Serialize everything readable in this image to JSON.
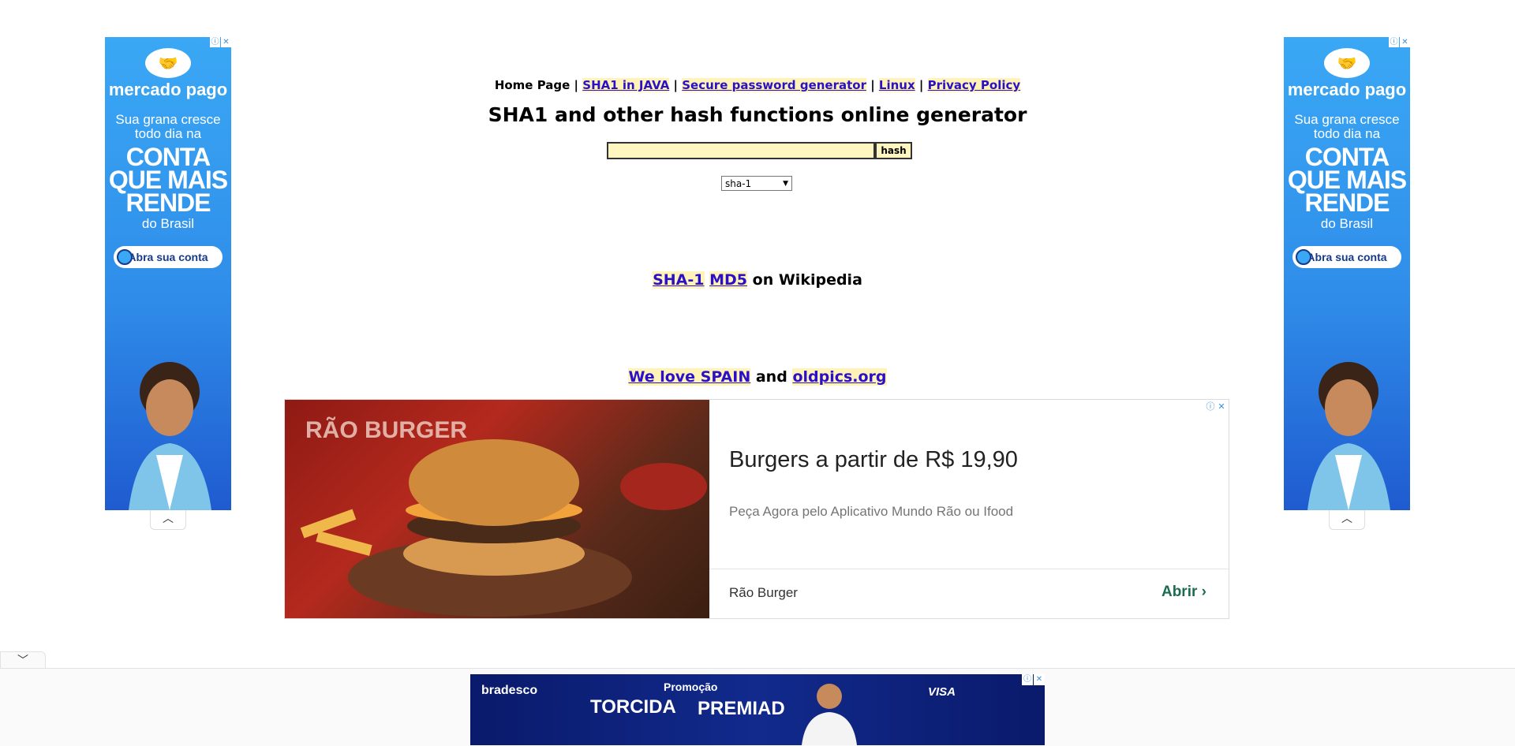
{
  "nav": {
    "home": "Home Page",
    "sep": " | ",
    "links": [
      "SHA1 in JAVA",
      "Secure password generator",
      "Linux",
      "Privacy Policy"
    ]
  },
  "page_title": "SHA1 and other hash functions online generator",
  "hash_form": {
    "input_value": "",
    "button_label": "hash",
    "algorithm_selected": "sha-1"
  },
  "wiki": {
    "link1": "SHA-1",
    "link2": "MD5",
    "suffix": "on Wikipedia"
  },
  "promo": {
    "link1": "We love SPAIN",
    "middle": "and",
    "link2": "oldpics.org"
  },
  "side_ad": {
    "brand": "mercado pago",
    "line1": "Sua grana cresce todo dia na",
    "big": "CONTA QUE MAIS RENDE",
    "small": "do Brasil",
    "cta": "Abra sua conta",
    "bg_color": "#3aa8f5"
  },
  "burger_ad": {
    "image_text": "RÃO BURGER",
    "headline": "Burgers a partir de R$ 19,90",
    "subtext": "Peça Agora pelo Aplicativo Mundo Rão ou Ifood",
    "advertiser": "Rão Burger",
    "cta": "Abrir"
  },
  "bottom_ad": {
    "brand": "bradesco",
    "promo": "Promoção",
    "word1": "TORCIDA",
    "word2": "PREMIAD",
    "sponsor": "VISA"
  },
  "icons": {
    "info": "ⓘ",
    "close": "✕",
    "up": "︿",
    "down": "﹀",
    "chevron": "›",
    "handshake": "🤝"
  }
}
